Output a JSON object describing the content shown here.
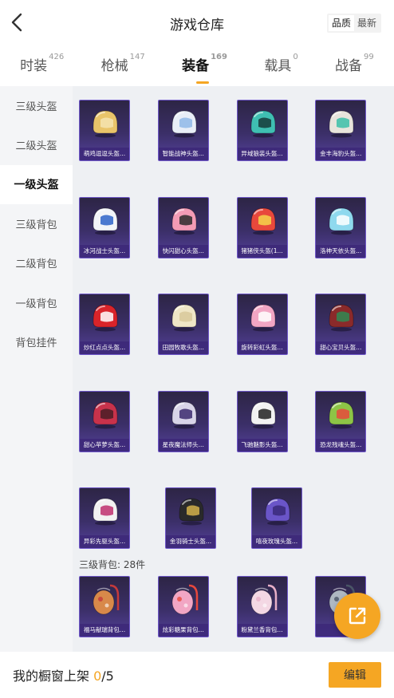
{
  "header": {
    "title": "游戏仓库",
    "sort_options": [
      "品质",
      "最新"
    ]
  },
  "tabs": [
    {
      "label": "时装",
      "count": "426"
    },
    {
      "label": "枪械",
      "count": "147"
    },
    {
      "label": "装备",
      "count": "169"
    },
    {
      "label": "载具",
      "count": "0"
    },
    {
      "label": "战备",
      "count": "99"
    }
  ],
  "sidebar": [
    "三级头盔",
    "二级头盔",
    "一级头盔",
    "三级背包",
    "二级背包",
    "一级背包",
    "背包挂件"
  ],
  "helmets": [
    {
      "name": "萌鸡逗逗头盔...",
      "color": "#e9c46a",
      "accent": "#f4e4b0"
    },
    {
      "name": "智能战神头盔...",
      "color": "#e8eef7",
      "accent": "#8fb8e8"
    },
    {
      "name": "异域狼装头盔...",
      "color": "#3fbfb2",
      "accent": "#163b3a"
    },
    {
      "name": "金丰海豹头盔...",
      "color": "#e8e4dc",
      "accent": "#3bbfa8"
    },
    {
      "name": "冰河战士头盔...",
      "color": "#f2f4f8",
      "accent": "#2e63c9"
    },
    {
      "name": "快闪甜心头盔...",
      "color": "#f39bb5",
      "accent": "#2b2b2b"
    },
    {
      "name": "猪猪侠头盔(1...",
      "color": "#e8483c",
      "accent": "#f5d64a"
    },
    {
      "name": "洛神天依头盔...",
      "color": "#8fd9ee",
      "accent": "#ffffff"
    },
    {
      "name": "炒红点点头盔...",
      "color": "#d9242a",
      "accent": "#ffffff"
    },
    {
      "name": "田园牧歌头盔...",
      "color": "#efe6c6",
      "accent": "#d8c89a"
    },
    {
      "name": "旋转彩虹头盔...",
      "color": "#f2a6c4",
      "accent": "#ffffff"
    },
    {
      "name": "甜心宝贝头盔...",
      "color": "#8a2a2a",
      "accent": "#2f8a52"
    },
    {
      "name": "甜心苹萝头盔...",
      "color": "#c8324b",
      "accent": "#4a1d26"
    },
    {
      "name": "星夜魔法师头...",
      "color": "#d8d4e8",
      "accent": "#3c2a6e"
    },
    {
      "name": "飞驰魅影头盔...",
      "color": "#f2f2f2",
      "accent": "#222222"
    },
    {
      "name": "恐龙残魂头盔...",
      "color": "#8dc446",
      "accent": "#e84a3c"
    },
    {
      "name": "异彩先驱头盔...",
      "color": "#f2f2f2",
      "accent": "#c0306e"
    },
    {
      "name": "金羽骑士头盔...",
      "color": "#2a2a2a",
      "accent": "#d4b24a"
    },
    {
      "name": "嘻夜玫瑰头盔...",
      "color": "#6a55c8",
      "accent": "#3a2a7a"
    }
  ],
  "section": {
    "label": "三级背包: 28件"
  },
  "backpacks": [
    {
      "name": "福马献瑞背包...",
      "color": "#d8894a",
      "accent": "#c63a3a"
    },
    {
      "name": "炫彩糖果背包...",
      "color": "#f2a6c4",
      "accent": "#e8483c"
    },
    {
      "name": "粉黛兰香背包...",
      "color": "#f4d8e4",
      "accent": "#e8b0c8"
    },
    {
      "name": "",
      "color": "#aeb8c2",
      "accent": "#4a5566"
    }
  ],
  "footer": {
    "prefix": "我的橱窗上架 ",
    "current": "0",
    "total": "/5",
    "edit_label": "编辑"
  }
}
